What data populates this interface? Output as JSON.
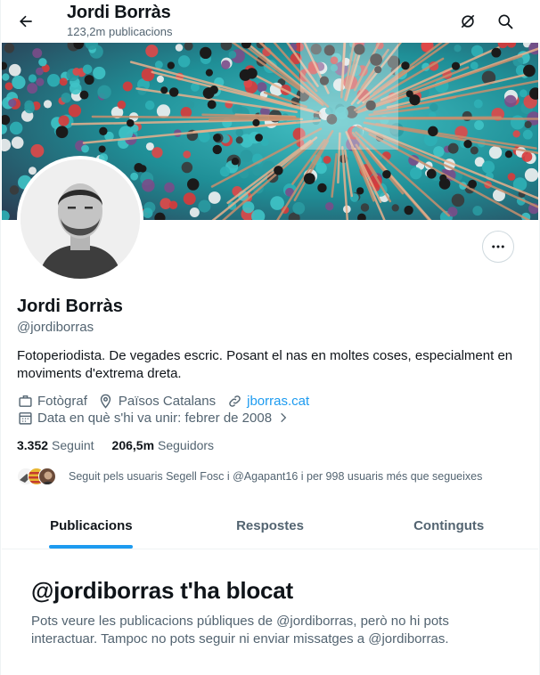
{
  "header": {
    "title": "Jordi Borràs",
    "subtitle": "123,2m publicacions"
  },
  "profile": {
    "name": "Jordi Borràs",
    "handle": "@jordiborras",
    "bio": "Fotoperiodista. De vegades escric. Posant el nas en moltes coses, especialment en moviments d'extrema dreta.",
    "occupation": "Fotògraf",
    "location": "Països Catalans",
    "website": "jborras.cat",
    "joined": "Data en què s'hi va unir: febrer de 2008",
    "following_count": "3.352",
    "following_label": "Seguint",
    "followers_count": "206,5m",
    "followers_label": "Seguidors",
    "followed_by": "Seguit pels usuaris Segell Fosc i @Agapant16 i per 998 usuaris més que segueixes"
  },
  "tabs": [
    {
      "label": "Publicacions",
      "active": true
    },
    {
      "label": "Respostes",
      "active": false
    },
    {
      "label": "Continguts",
      "active": false
    }
  ],
  "blocked": {
    "title": "@jordiborras t'ha blocat",
    "body": "Pots veure les publicacions públiques de @jordiborras, però no hi pots interactuar. Tampoc no pots seguir ni enviar missatges a @jordiborras."
  },
  "colors": {
    "accent": "#1d9bf0",
    "text_primary": "#0f1419",
    "text_secondary": "#536471"
  },
  "icons": {
    "back": "arrow-left-icon",
    "translate": "translate-off-icon",
    "search": "search-icon",
    "more": "more-horizontal-icon",
    "occupation": "briefcase-icon",
    "location": "location-pin-icon",
    "website": "link-icon",
    "joined": "calendar-icon",
    "chevron": "chevron-right-icon"
  }
}
